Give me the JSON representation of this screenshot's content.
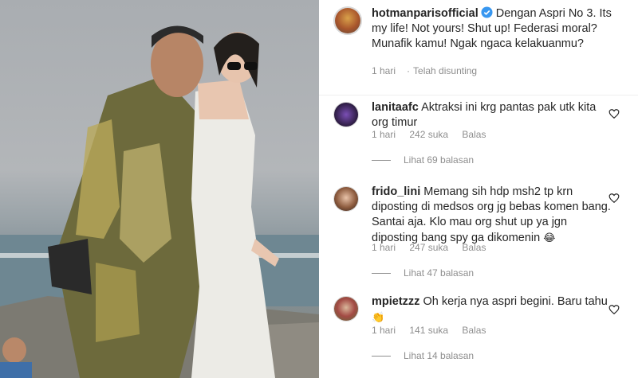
{
  "post": {
    "username": "hotmanparisofficial",
    "caption": "Dengan Aspri No 3. Its my life! Not yours! Shut up! Federasi moral? Munafik kamu! Ngak ngaca kelakuanmu?",
    "time": "1 hari",
    "edited": "Telah disunting"
  },
  "comments": [
    {
      "username": "lanitaafc",
      "text": "Aktraksi ini krg pantas pak utk kita org timur",
      "emoji": "",
      "time": "1 hari",
      "likes": "242 suka",
      "reply": "Balas",
      "view_replies": "Lihat 69 balasan"
    },
    {
      "username": "frido_lini",
      "text": "Memang sih hdp msh2 tp krn diposting di medsos org jg bebas komen bang. Santai aja. Klo mau org shut up ya jgn diposting bang spy ga dikomenin",
      "emoji": "😂",
      "time": "1 hari",
      "likes": "247 suka",
      "reply": "Balas",
      "view_replies": "Lihat 47 balasan"
    },
    {
      "username": "mpietzzz",
      "text": "Oh kerja nya aspri begini. Baru tahu",
      "emoji": "👏",
      "time": "1 hari",
      "likes": "141 suka",
      "reply": "Balas",
      "view_replies": "Lihat 14 balasan"
    }
  ],
  "icons": {
    "verified": "verified-badge-icon",
    "like": "heart-outline-icon"
  },
  "colors": {
    "verified": "#3897f0",
    "meta_text": "#8e8e8e",
    "text": "#262626"
  }
}
